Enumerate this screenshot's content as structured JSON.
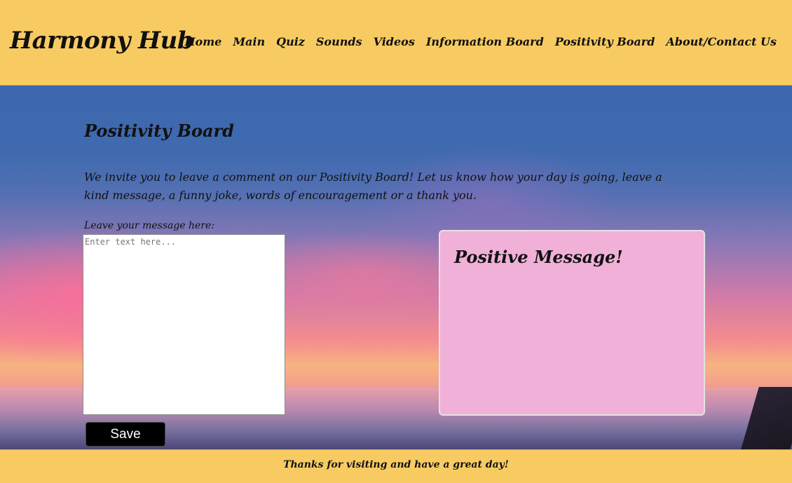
{
  "header": {
    "brand": "Harmony Hub",
    "nav": [
      "Home",
      "Main",
      "Quiz",
      "Sounds",
      "Videos",
      "Information Board",
      "Positivity Board",
      "About/Contact Us"
    ]
  },
  "content": {
    "title": "Positivity Board",
    "intro": "We invite you to leave a comment on our Positivity Board! Let us know how your day is going, leave a kind message, a funny joke, words of encouragement or a thank you.",
    "message_label": "Leave your message here:",
    "message_placeholder": "Enter text here...",
    "save_label": "Save"
  },
  "message_card": {
    "title": "Positive Message!"
  },
  "footer": {
    "text": "Thanks for visiting and have a great day!"
  },
  "colors": {
    "header_bg": "#f8cb62",
    "card_bg": "#f1b0d8",
    "button_bg": "#000000"
  }
}
